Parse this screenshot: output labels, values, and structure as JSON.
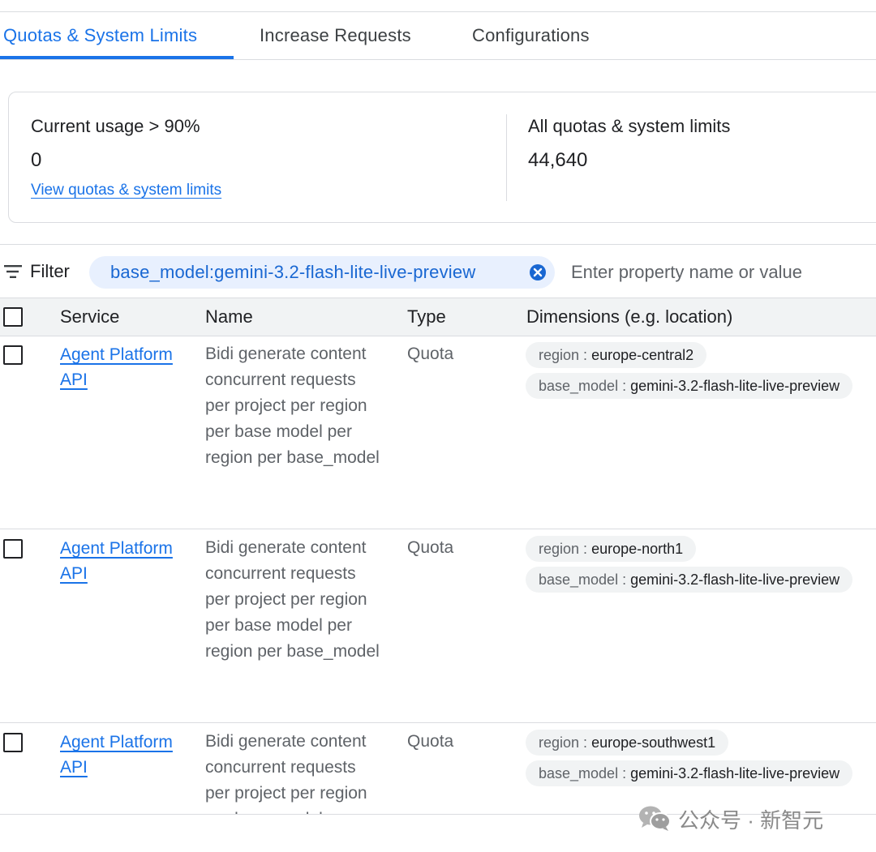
{
  "tabs": [
    {
      "label": "Quotas & System Limits"
    },
    {
      "label": "Increase Requests"
    },
    {
      "label": "Configurations"
    }
  ],
  "summary": {
    "usage_heading": "Current usage > 90%",
    "usage_value": "0",
    "view_link": "View quotas & system limits",
    "all_heading": "All quotas & system limits",
    "all_value": "44,640"
  },
  "filter": {
    "label": "Filter",
    "chip_text": "base_model:gemini-3.2-flash-lite-live-preview",
    "placeholder": "Enter property name or value"
  },
  "table": {
    "columns": {
      "service": "Service",
      "name": "Name",
      "type": "Type",
      "dimensions": "Dimensions (e.g. location)"
    },
    "rows": [
      {
        "service": "Agent Platform API",
        "name": "Bidi generate content concurrent requests per project per region per base model per region per base_model",
        "type": "Quota",
        "dim_region_key": "region :",
        "dim_region_val": "europe-central2",
        "dim_model_key": "base_model :",
        "dim_model_val": "gemini-3.2-flash-lite-live-preview"
      },
      {
        "service": "Agent Platform API",
        "name": "Bidi generate content concurrent requests per project per region per base model per region per base_model",
        "type": "Quota",
        "dim_region_key": "region :",
        "dim_region_val": "europe-north1",
        "dim_model_key": "base_model :",
        "dim_model_val": "gemini-3.2-flash-lite-live-preview"
      },
      {
        "service": "Agent Platform API",
        "name": "Bidi generate content concurrent requests per project per region per base model per region per base_model",
        "type": "Quota",
        "dim_region_key": "region :",
        "dim_region_val": "europe-southwest1",
        "dim_model_key": "base_model :",
        "dim_model_val": "gemini-3.2-flash-lite-live-preview"
      }
    ]
  },
  "watermark": {
    "text": "公众号 · 新智元"
  },
  "colors": {
    "accent": "#1a73e8",
    "chip_bg": "#e8f0fe",
    "header_bg": "#f1f3f4",
    "border": "#dadce0"
  },
  "icons": [
    "filter-icon",
    "close-circle-icon",
    "wechat-icon"
  ]
}
